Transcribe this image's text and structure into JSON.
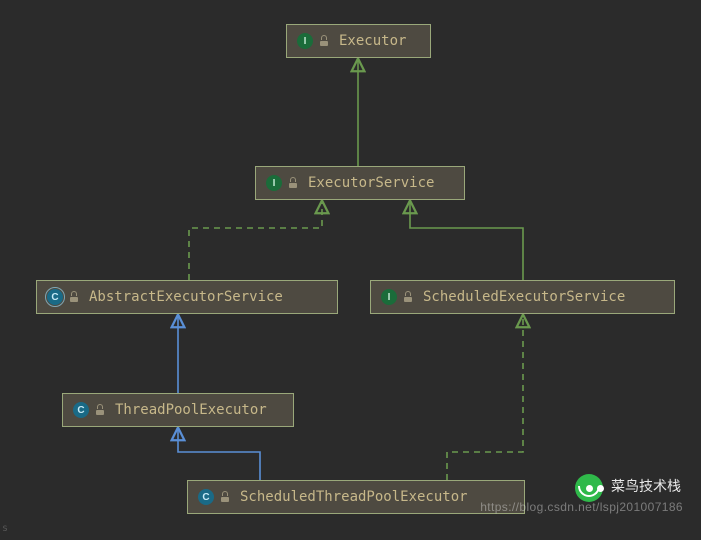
{
  "nodes": {
    "executor": {
      "label": "Executor",
      "icon": "I",
      "kind": "i"
    },
    "executorService": {
      "label": "ExecutorService",
      "icon": "I",
      "kind": "i"
    },
    "abstractExecSvc": {
      "label": "AbstractExecutorService",
      "icon": "C",
      "kind": "ca"
    },
    "scheduledExecSvc": {
      "label": "ScheduledExecutorService",
      "icon": "I",
      "kind": "i"
    },
    "threadPoolExecutor": {
      "label": "ThreadPoolExecutor",
      "icon": "C",
      "kind": "c"
    },
    "scheduledTPExecutor": {
      "label": "ScheduledThreadPoolExecutor",
      "icon": "C",
      "kind": "c"
    }
  },
  "watermark": {
    "brand": "菜鸟技术栈",
    "url": "https://blog.csdn.net/lspj201007186"
  },
  "corner_mark": "s",
  "colors": {
    "extends": "#5a8fd6",
    "implements": "#6a994e"
  }
}
